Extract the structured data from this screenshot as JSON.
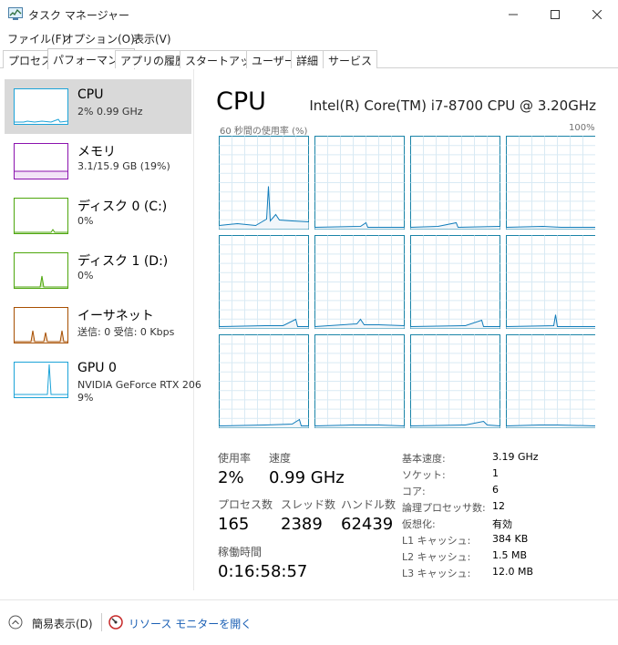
{
  "window": {
    "title": "タスク マネージャー",
    "app_icon": "task-manager-icon",
    "minimize_icon": "minimize-icon",
    "maximize_icon": "maximize-icon",
    "close_icon": "close-icon"
  },
  "menu": [
    {
      "label": "ファイル(F)"
    },
    {
      "label": "オプション(O)"
    },
    {
      "label": "表示(V)"
    }
  ],
  "tabs": [
    {
      "label": "プロセス"
    },
    {
      "label": "パフォーマンス",
      "active": true
    },
    {
      "label": "アプリの履歴"
    },
    {
      "label": "スタートアップ"
    },
    {
      "label": "ユーザー"
    },
    {
      "label": "詳細"
    },
    {
      "label": "サービス"
    }
  ],
  "sidebar": {
    "items": [
      {
        "title": "CPU",
        "sub1": "2%  0.99 GHz",
        "sub2": "",
        "color": "#1ca3d8",
        "selected": true
      },
      {
        "title": "メモリ",
        "sub1": "3.1/15.9 GB (19%)",
        "sub2": "",
        "color": "#8b12ae"
      },
      {
        "title": "ディスク 0 (C:)",
        "sub1": "0%",
        "sub2": "",
        "color": "#4da60c"
      },
      {
        "title": "ディスク 1 (D:)",
        "sub1": "0%",
        "sub2": "",
        "color": "#4da60c"
      },
      {
        "title": "イーサネット",
        "sub1": "送信: 0  受信: 0 Kbps",
        "sub2": "",
        "color": "#a74f01"
      },
      {
        "title": "GPU 0",
        "sub1": "NVIDIA GeForce RTX 206",
        "sub2": "9%",
        "color": "#1ca3d8"
      }
    ]
  },
  "main": {
    "title": "CPU",
    "model": "Intel(R) Core(TM) i7-8700 CPU @ 3.20GHz",
    "graph_label_left": "60 秒間の使用率 (%)",
    "graph_label_right": "100%",
    "graph_color": "#117dbb",
    "graph_border": "#1a84a8"
  },
  "stats": {
    "usage_label": "使用率",
    "usage_value": "2%",
    "speed_label": "速度",
    "speed_value": "0.99 GHz",
    "processes_label": "プロセス数",
    "processes_value": "165",
    "threads_label": "スレッド数",
    "threads_value": "2389",
    "handles_label": "ハンドル数",
    "handles_value": "62439",
    "uptime_label": "稼働時間",
    "uptime_value": "0:16:58:57"
  },
  "info": [
    {
      "key": "基本速度:",
      "value": "3.19 GHz"
    },
    {
      "key": "ソケット:",
      "value": "1"
    },
    {
      "key": "コア:",
      "value": "6"
    },
    {
      "key": "論理プロセッサ数:",
      "value": "12"
    },
    {
      "key": "仮想化:",
      "value": "有効"
    },
    {
      "key": "L1 キャッシュ:",
      "value": "384 KB"
    },
    {
      "key": "L2 キャッシュ:",
      "value": "1.5 MB"
    },
    {
      "key": "L3 キャッシュ:",
      "value": "12.0 MB"
    }
  ],
  "footer": {
    "simple_view": "簡易表示(D)",
    "resource_monitor": "リソース モニターを開く",
    "simple_view_icon": "chevron-up-circle-icon",
    "resource_monitor_icon": "resource-monitor-icon"
  }
}
